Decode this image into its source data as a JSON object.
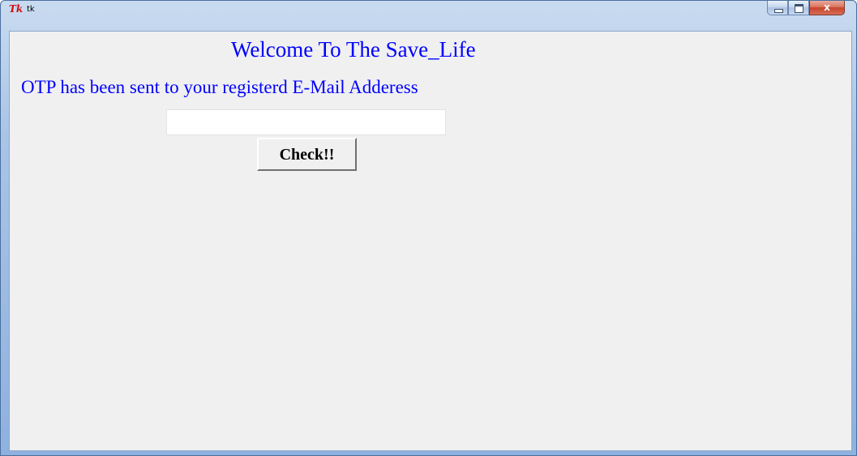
{
  "window": {
    "title": "tk",
    "icon_text": "Tk",
    "controls": {
      "minimize": "minimize-icon",
      "maximize": "maximize-icon",
      "close": "close-icon",
      "close_glyph": "x"
    }
  },
  "main": {
    "welcome_text": "Welcome To The Save_Life",
    "otp_message": "OTP has been sent to your registerd E-Mail Adderess",
    "otp_input": {
      "value": "",
      "placeholder": ""
    },
    "check_button_label": "Check!!"
  },
  "colors": {
    "text_accent": "#0000ff",
    "client_background": "#f0f0f0"
  }
}
